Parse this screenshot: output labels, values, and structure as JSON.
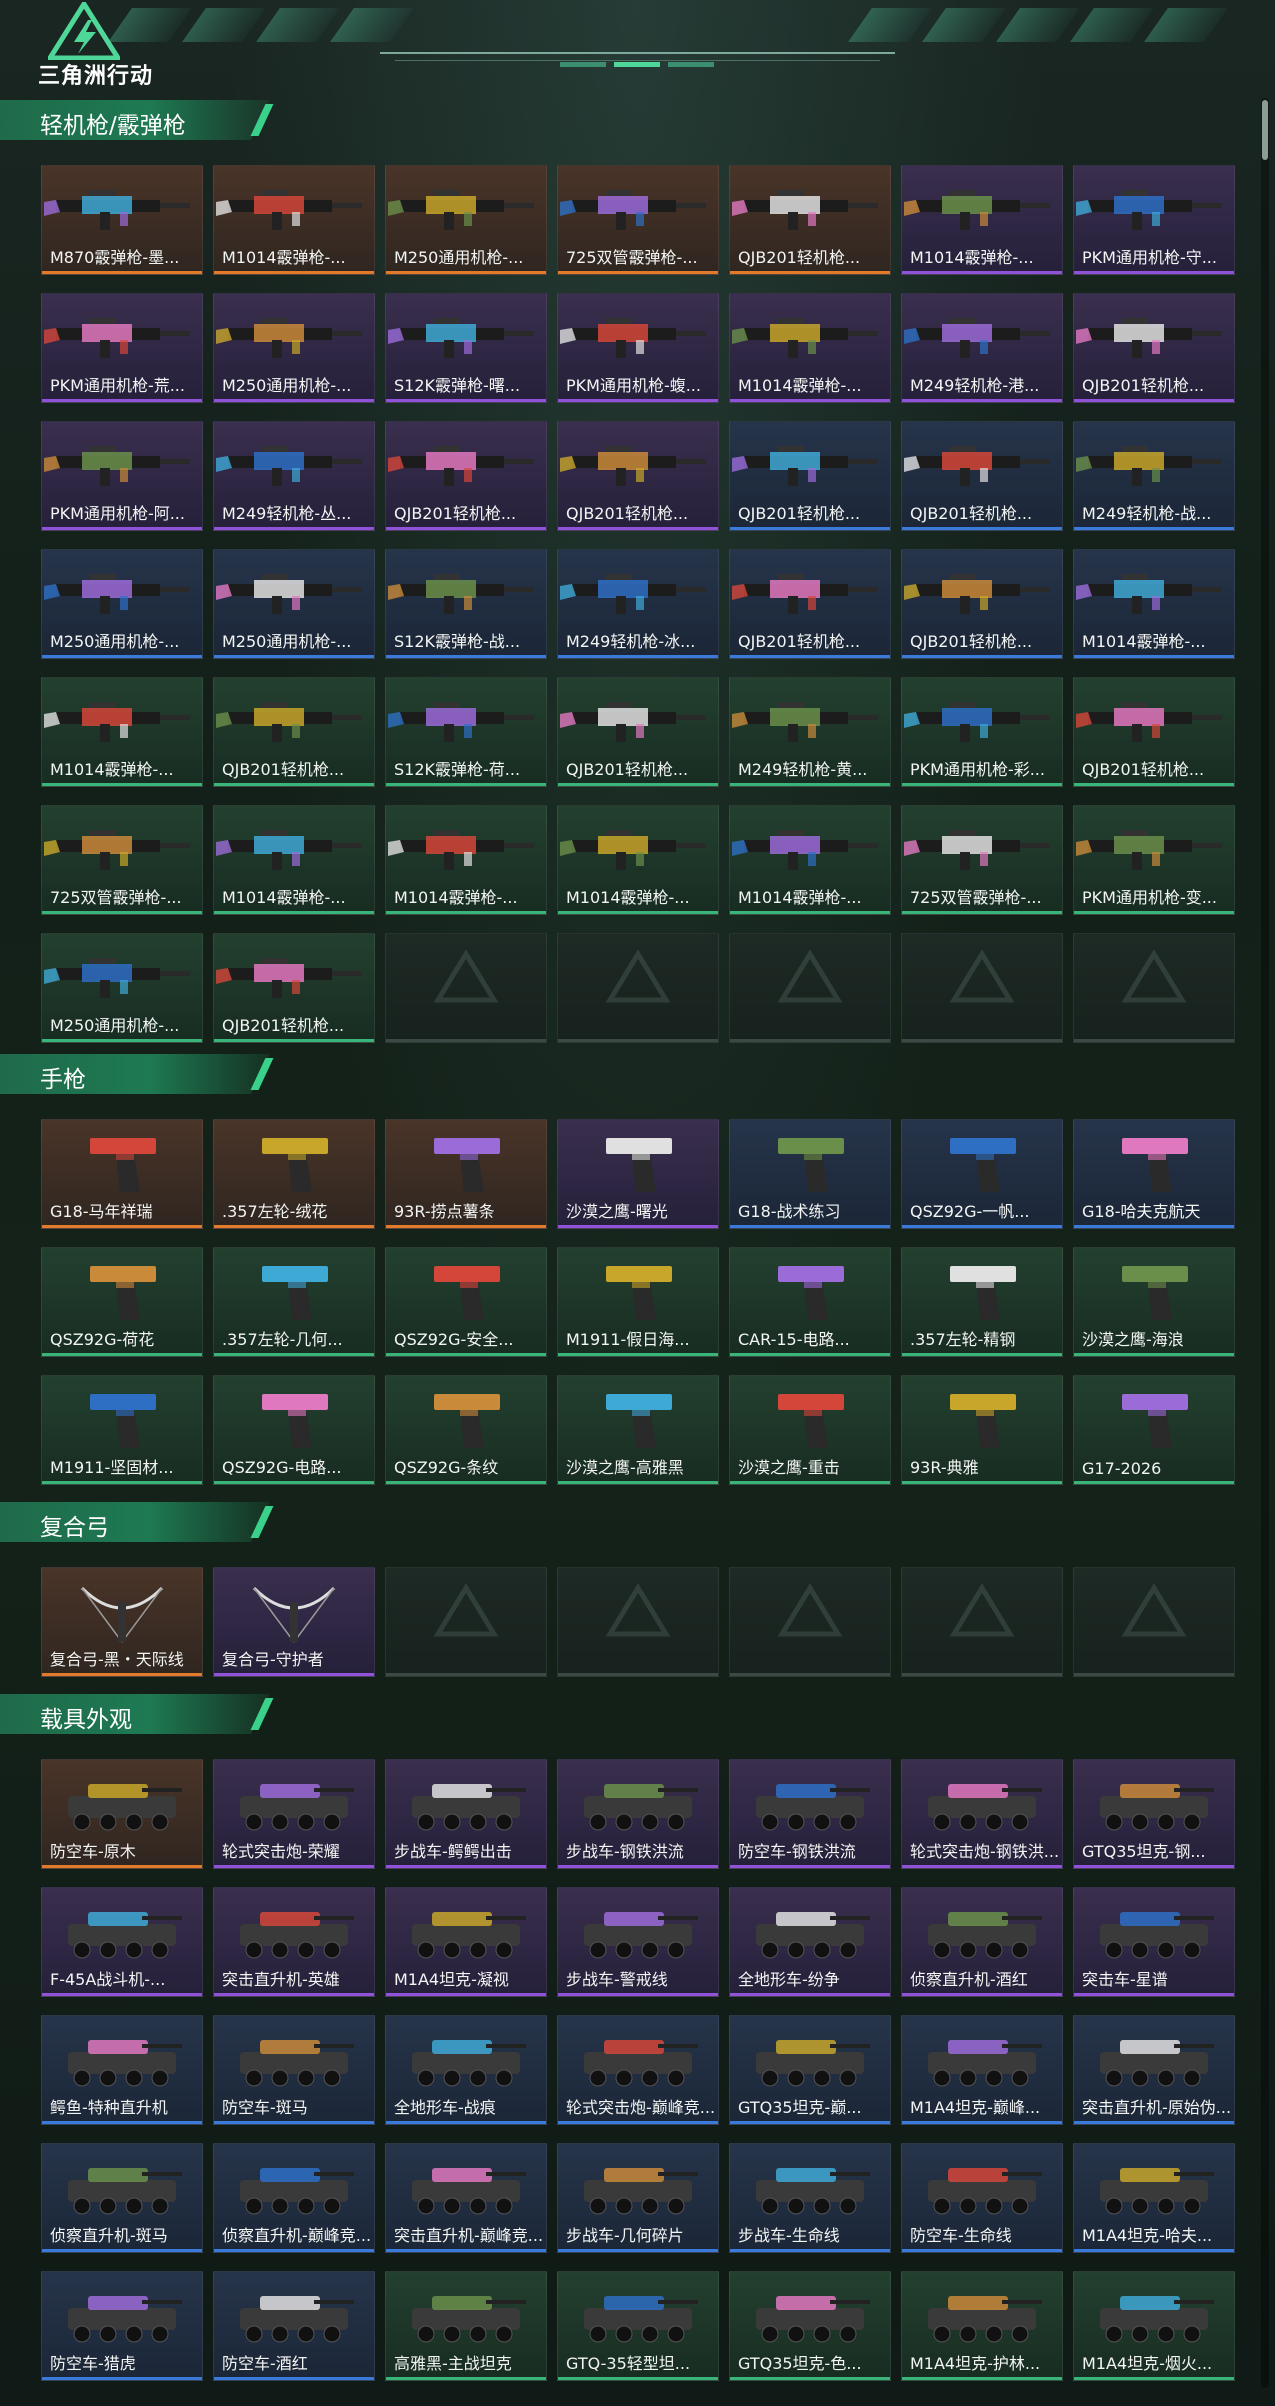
{
  "header": {
    "logo_text": "三角洲行动"
  },
  "colors": {
    "accent": "#3ad18a",
    "orange": "#e27a2b",
    "purple": "#8f52d8",
    "blue": "#3a7ad9",
    "green": "#39b57a"
  },
  "sections": [
    {
      "title": "轻机枪/霰弹枪",
      "kind": "gun",
      "items": [
        {
          "label": "M870霰弹枪-墨...",
          "rarity": "orange"
        },
        {
          "label": "M1014霰弹枪-...",
          "rarity": "orange"
        },
        {
          "label": "M250通用机枪-...",
          "rarity": "orange"
        },
        {
          "label": "725双管霰弹枪-...",
          "rarity": "orange"
        },
        {
          "label": "QJB201轻机枪...",
          "rarity": "orange"
        },
        {
          "label": "M1014霰弹枪-...",
          "rarity": "purple"
        },
        {
          "label": "PKM通用机枪-守...",
          "rarity": "purple"
        },
        {
          "label": "PKM通用机枪-荒...",
          "rarity": "purple"
        },
        {
          "label": "M250通用机枪-...",
          "rarity": "purple"
        },
        {
          "label": "S12K霰弹枪-曙...",
          "rarity": "purple"
        },
        {
          "label": "PKM通用机枪-蝮...",
          "rarity": "purple"
        },
        {
          "label": "M1014霰弹枪-...",
          "rarity": "purple"
        },
        {
          "label": "M249轻机枪-港...",
          "rarity": "purple"
        },
        {
          "label": "QJB201轻机枪...",
          "rarity": "purple"
        },
        {
          "label": "PKM通用机枪-阿...",
          "rarity": "purple"
        },
        {
          "label": "M249轻机枪-丛...",
          "rarity": "purple"
        },
        {
          "label": "QJB201轻机枪...",
          "rarity": "purple"
        },
        {
          "label": "QJB201轻机枪...",
          "rarity": "purple"
        },
        {
          "label": "QJB201轻机枪...",
          "rarity": "blue"
        },
        {
          "label": "QJB201轻机枪...",
          "rarity": "blue"
        },
        {
          "label": "M249轻机枪-战...",
          "rarity": "blue"
        },
        {
          "label": "M250通用机枪-...",
          "rarity": "blue"
        },
        {
          "label": "M250通用机枪-...",
          "rarity": "blue"
        },
        {
          "label": "S12K霰弹枪-战...",
          "rarity": "blue"
        },
        {
          "label": "M249轻机枪-冰...",
          "rarity": "blue"
        },
        {
          "label": "QJB201轻机枪...",
          "rarity": "blue"
        },
        {
          "label": "QJB201轻机枪...",
          "rarity": "blue"
        },
        {
          "label": "M1014霰弹枪-...",
          "rarity": "blue"
        },
        {
          "label": "M1014霰弹枪-...",
          "rarity": "green"
        },
        {
          "label": "QJB201轻机枪...",
          "rarity": "green"
        },
        {
          "label": "S12K霰弹枪-荷...",
          "rarity": "green"
        },
        {
          "label": "QJB201轻机枪...",
          "rarity": "green"
        },
        {
          "label": "M249轻机枪-黄...",
          "rarity": "green"
        },
        {
          "label": "PKM通用机枪-彩...",
          "rarity": "green"
        },
        {
          "label": "QJB201轻机枪...",
          "rarity": "green"
        },
        {
          "label": "725双管霰弹枪-...",
          "rarity": "green"
        },
        {
          "label": "M1014霰弹枪-...",
          "rarity": "green"
        },
        {
          "label": "M1014霰弹枪-...",
          "rarity": "green"
        },
        {
          "label": "M1014霰弹枪-...",
          "rarity": "green"
        },
        {
          "label": "M1014霰弹枪-...",
          "rarity": "green"
        },
        {
          "label": "725双管霰弹枪-...",
          "rarity": "green"
        },
        {
          "label": "PKM通用机枪-变...",
          "rarity": "green"
        },
        {
          "label": "M250通用机枪-...",
          "rarity": "green"
        },
        {
          "label": "QJB201轻机枪...",
          "rarity": "green"
        },
        {
          "label": "",
          "rarity": "empty"
        },
        {
          "label": "",
          "rarity": "empty"
        },
        {
          "label": "",
          "rarity": "empty"
        },
        {
          "label": "",
          "rarity": "empty"
        },
        {
          "label": "",
          "rarity": "empty"
        }
      ]
    },
    {
      "title": "手枪",
      "kind": "pistol",
      "items": [
        {
          "label": "G18-马年祥瑞",
          "rarity": "orange"
        },
        {
          "label": ".357左轮-绒花",
          "rarity": "orange"
        },
        {
          "label": "93R-捞点薯条",
          "rarity": "orange"
        },
        {
          "label": "沙漠之鹰-曙光",
          "rarity": "purple"
        },
        {
          "label": "G18-战术练习",
          "rarity": "blue"
        },
        {
          "label": "QSZ92G-一帆...",
          "rarity": "blue"
        },
        {
          "label": "G18-哈夫克航天",
          "rarity": "blue"
        },
        {
          "label": "QSZ92G-荷花",
          "rarity": "green"
        },
        {
          "label": ".357左轮-几何...",
          "rarity": "green"
        },
        {
          "label": "QSZ92G-安全...",
          "rarity": "green"
        },
        {
          "label": "M1911-假日海...",
          "rarity": "green"
        },
        {
          "label": "CAR-15-电路...",
          "rarity": "green"
        },
        {
          "label": ".357左轮-精钢",
          "rarity": "green"
        },
        {
          "label": "沙漠之鹰-海浪",
          "rarity": "green"
        },
        {
          "label": "M1911-坚固材...",
          "rarity": "green"
        },
        {
          "label": "QSZ92G-电路...",
          "rarity": "green"
        },
        {
          "label": "QSZ92G-条纹",
          "rarity": "green"
        },
        {
          "label": "沙漠之鹰-高雅黑",
          "rarity": "green"
        },
        {
          "label": "沙漠之鹰-重击",
          "rarity": "green"
        },
        {
          "label": "93R-典雅",
          "rarity": "green"
        },
        {
          "label": "G17-2026",
          "rarity": "green"
        }
      ]
    },
    {
      "title": "复合弓",
      "kind": "bow",
      "items": [
        {
          "label": "复合弓-黑・天际线",
          "rarity": "orange"
        },
        {
          "label": "复合弓-守护者",
          "rarity": "purple"
        },
        {
          "label": "",
          "rarity": "empty"
        },
        {
          "label": "",
          "rarity": "empty"
        },
        {
          "label": "",
          "rarity": "empty"
        },
        {
          "label": "",
          "rarity": "empty"
        },
        {
          "label": "",
          "rarity": "empty"
        }
      ]
    },
    {
      "title": "载具外观",
      "kind": "vehicle",
      "items": [
        {
          "label": "防空车-原木",
          "rarity": "orange"
        },
        {
          "label": "轮式突击炮-荣耀",
          "rarity": "purple"
        },
        {
          "label": "步战车-鳄鳄出击",
          "rarity": "purple"
        },
        {
          "label": "步战车-钢铁洪流",
          "rarity": "purple"
        },
        {
          "label": "防空车-钢铁洪流",
          "rarity": "purple"
        },
        {
          "label": "轮式突击炮-钢铁洪...",
          "rarity": "purple"
        },
        {
          "label": "GTQ35坦克-钢...",
          "rarity": "purple"
        },
        {
          "label": "F-45A战斗机-...",
          "rarity": "purple"
        },
        {
          "label": "突击直升机-英雄",
          "rarity": "purple"
        },
        {
          "label": "M1A4坦克-凝视",
          "rarity": "purple"
        },
        {
          "label": "步战车-警戒线",
          "rarity": "purple"
        },
        {
          "label": "全地形车-纷争",
          "rarity": "purple"
        },
        {
          "label": "侦察直升机-酒红",
          "rarity": "purple"
        },
        {
          "label": "突击车-星谱",
          "rarity": "purple"
        },
        {
          "label": "鳄鱼-特种直升机",
          "rarity": "blue"
        },
        {
          "label": "防空车-斑马",
          "rarity": "blue"
        },
        {
          "label": "全地形车-战痕",
          "rarity": "blue"
        },
        {
          "label": "轮式突击炮-巅峰竞...",
          "rarity": "blue"
        },
        {
          "label": "GTQ35坦克-巅...",
          "rarity": "blue"
        },
        {
          "label": "M1A4坦克-巅峰...",
          "rarity": "blue"
        },
        {
          "label": "突击直升机-原始伪...",
          "rarity": "blue"
        },
        {
          "label": "侦察直升机-斑马",
          "rarity": "blue"
        },
        {
          "label": "侦察直升机-巅峰竞...",
          "rarity": "blue"
        },
        {
          "label": "突击直升机-巅峰竞...",
          "rarity": "blue"
        },
        {
          "label": "步战车-几何碎片",
          "rarity": "blue"
        },
        {
          "label": "步战车-生命线",
          "rarity": "blue"
        },
        {
          "label": "防空车-生命线",
          "rarity": "blue"
        },
        {
          "label": "M1A4坦克-哈夫...",
          "rarity": "blue"
        },
        {
          "label": "防空车-猎虎",
          "rarity": "blue"
        },
        {
          "label": "防空车-酒红",
          "rarity": "blue"
        },
        {
          "label": "高雅黑-主战坦克",
          "rarity": "green"
        },
        {
          "label": "GTQ-35轻型坦...",
          "rarity": "green"
        },
        {
          "label": "GTQ35坦克-色...",
          "rarity": "green"
        },
        {
          "label": "M1A4坦克-护林...",
          "rarity": "green"
        },
        {
          "label": "M1A4坦克-烟火...",
          "rarity": "green"
        }
      ]
    }
  ]
}
